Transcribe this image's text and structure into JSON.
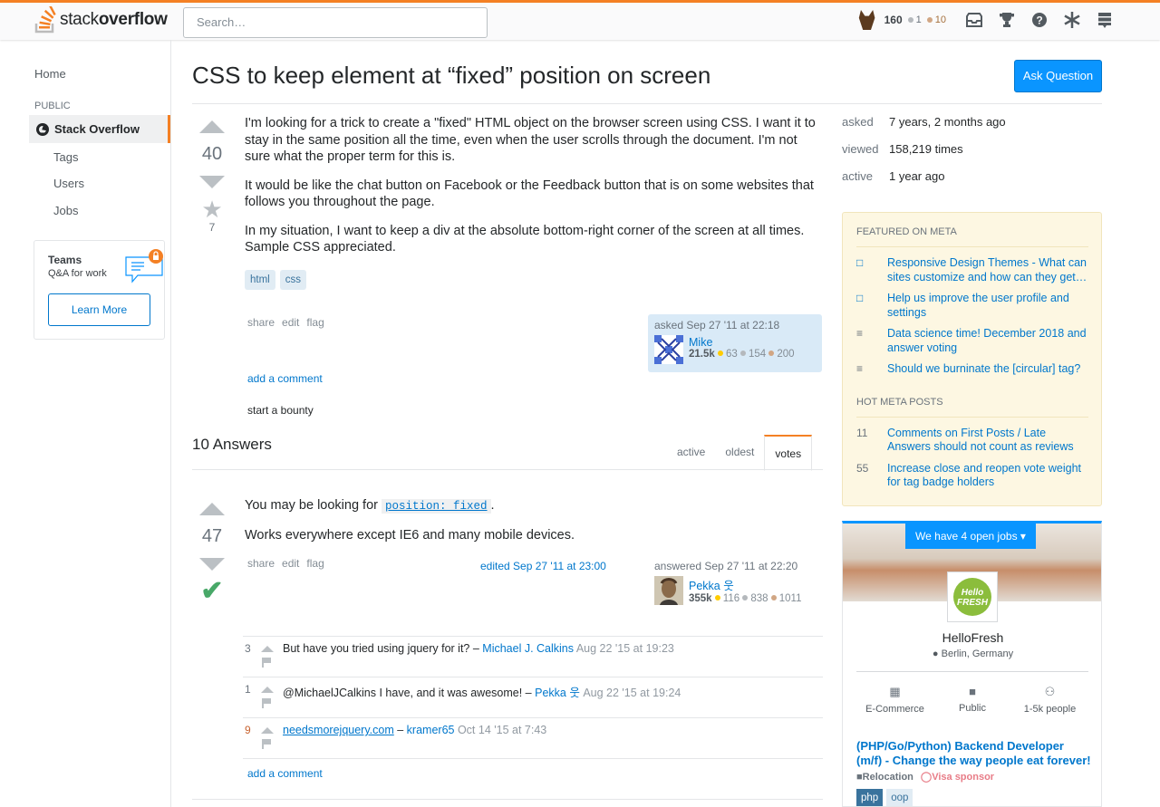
{
  "topbar": {
    "logo_light": "stack",
    "logo_bold": "overflow",
    "search_placeholder": "Search…",
    "reputation": "160",
    "silver_count": "1",
    "bronze_count": "10",
    "icons": [
      "inbox-icon",
      "achievements-icon",
      "help-icon",
      "stackexchange-icon",
      "review-queue-icon"
    ]
  },
  "leftnav": {
    "home": "Home",
    "public_heading": "PUBLIC",
    "stack_overflow": "Stack Overflow",
    "tags": "Tags",
    "users": "Users",
    "jobs": "Jobs",
    "teams_title": "Teams",
    "teams_sub": "Q&A for work",
    "learn_more": "Learn More"
  },
  "question": {
    "title": "CSS to keep element at “fixed” position on screen",
    "ask_button": "Ask Question",
    "votes": "40",
    "favorites": "7",
    "paragraphs": [
      "I'm looking for a trick to create a \"fixed\" HTML object on the browser screen using CSS. I want it to stay in the same position all the time, even when the user scrolls through the document. I'm not sure what the proper term for this is.",
      "It would be like the chat button on Facebook or the Feedback button that is on some websites that follows you throughout the page.",
      "In my situation, I want to keep a div at the absolute bottom-right corner of the screen at all times. Sample CSS appreciated."
    ],
    "tags": [
      "html",
      "css"
    ],
    "menu": [
      "share",
      "edit",
      "flag"
    ],
    "asked_time": "asked Sep 27 '11 at 22:18",
    "user_name": "Mike",
    "user_rep": "21.5k",
    "user_gold": "63",
    "user_silver": "154",
    "user_bronze": "200",
    "add_comment": "add a comment",
    "start_bounty": "start a bounty"
  },
  "answers_header": {
    "count_label": "10 Answers",
    "tabs": [
      "active",
      "oldest",
      "votes"
    ]
  },
  "answer": {
    "votes": "47",
    "line1_prefix": "You may be looking for",
    "line1_code": "position: fixed",
    "line1_suffix": ".",
    "line2": "Works everywhere except IE6 and many mobile devices.",
    "menu": [
      "share",
      "edit",
      "flag"
    ],
    "edited": "edited Sep 27 '11 at 23:00",
    "answered_time": "answered Sep 27 '11 at 22:20",
    "user_name": "Pekka 웃",
    "user_rep": "355k",
    "user_gold": "116",
    "user_silver": "838",
    "user_bronze": "1011",
    "add_comment": "add a comment"
  },
  "comments": [
    {
      "score": "3",
      "text": "But have you tried using jquery for it? –",
      "user": "Michael J. Calkins",
      "date": "Aug 22 '15 at 19:23"
    },
    {
      "score": "1",
      "text": "@MichaelJCalkins I have, and it was awesome! –",
      "user": "Pekka 웃",
      "date": "Aug 22 '15 at 19:24"
    },
    {
      "score": "9",
      "link": "needsmorejquery.com",
      "text": " –",
      "user": "kramer65",
      "date": "Oct 14 '15 at 7:43"
    }
  ],
  "stats": [
    {
      "label": "asked",
      "value": "7 years, 2 months ago"
    },
    {
      "label": "viewed",
      "value": "158,219 times"
    },
    {
      "label": "active",
      "value": "1 year ago"
    }
  ],
  "meta": {
    "featured_heading": "FEATURED ON META",
    "featured": [
      "Responsive Design Themes - What can sites customize and how can they get…",
      "Help us improve the user profile and settings",
      "Data science time! December 2018 and answer voting",
      "Should we burninate the [circular] tag?"
    ],
    "hot_heading": "HOT META POSTS",
    "hot": [
      {
        "count": "11",
        "title": "Comments on First Posts / Late Answers should not count as reviews"
      },
      {
        "count": "55",
        "title": "Increase close and reopen vote weight for tag badge holders"
      }
    ]
  },
  "jobs": {
    "banner": "We have 4 open jobs ▾",
    "logo_text": "Hello FRESH",
    "company": "HelloFresh",
    "location": "Berlin, Germany",
    "facts": [
      "E-Commerce",
      "Public",
      "1-5k people"
    ],
    "job_title": "(PHP/Go/Python) Backend Developer (m/f) - Change the way people eat forever!",
    "relocation": "Relocation",
    "visa": "Visa sponsor",
    "tags": [
      "php",
      "oop"
    ]
  },
  "colors": {
    "accent": "#f48024",
    "link": "#0077cc",
    "primary_button": "#0a95ff",
    "accepted": "#48a868"
  }
}
